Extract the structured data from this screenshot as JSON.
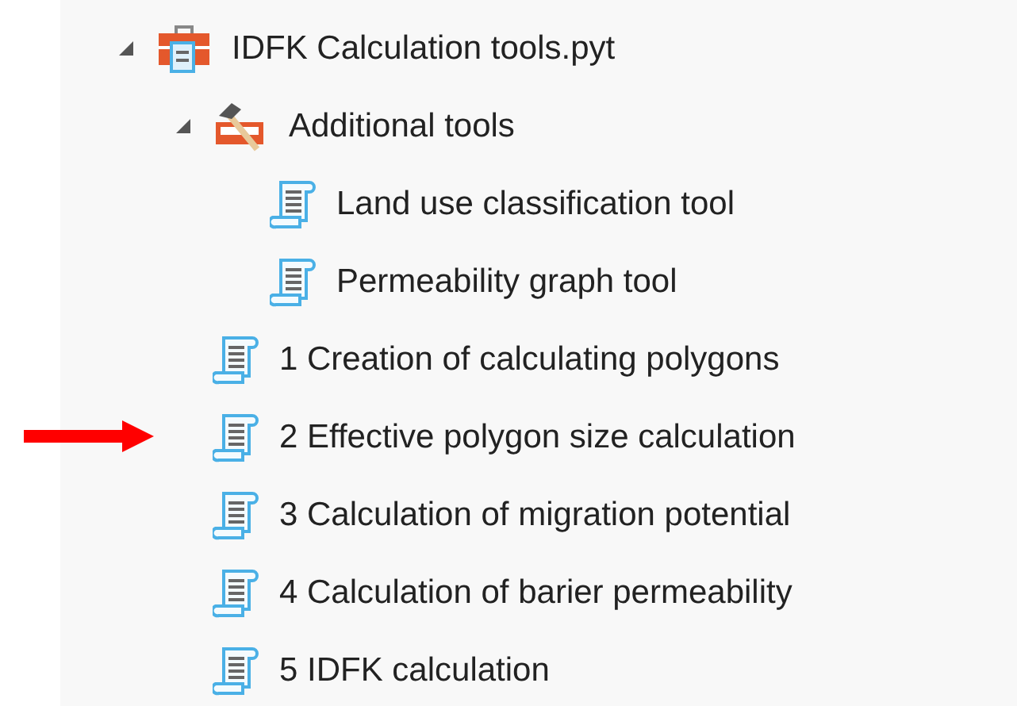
{
  "tree": [
    {
      "label": "IDFK Calculation tools.pyt",
      "kind": "toolbox",
      "expanded": true,
      "pointed": false,
      "children": [
        {
          "label": "Additional tools",
          "kind": "toolset",
          "expanded": true,
          "pointed": false,
          "children": [
            {
              "label": "Land use classification tool",
              "kind": "tool",
              "pointed": false
            },
            {
              "label": "Permeability graph tool",
              "kind": "tool",
              "pointed": false
            }
          ]
        },
        {
          "label": "1 Creation of calculating polygons",
          "kind": "tool",
          "pointed": false
        },
        {
          "label": "2 Effective polygon size calculation",
          "kind": "tool",
          "pointed": true
        },
        {
          "label": "3 Calculation of migration potential",
          "kind": "tool",
          "pointed": false
        },
        {
          "label": "4 Calculation of barier permeability",
          "kind": "tool",
          "pointed": false
        },
        {
          "label": "5 IDFK calculation",
          "kind": "tool",
          "pointed": false
        }
      ]
    }
  ]
}
